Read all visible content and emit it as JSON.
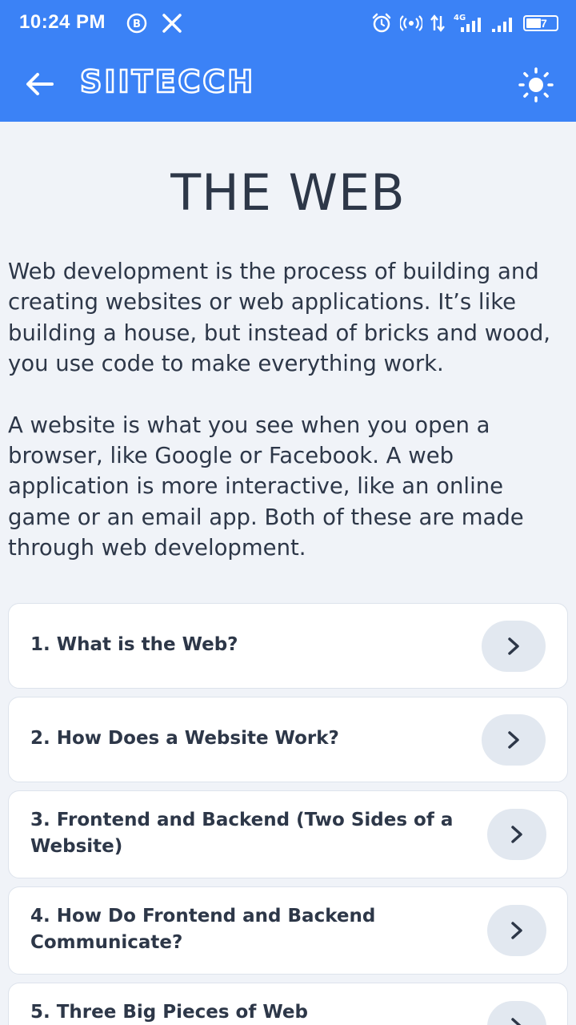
{
  "status_bar": {
    "time": "10:24 PM",
    "left_icons": [
      "b-circle-icon",
      "x-logo-icon"
    ],
    "right_icons": [
      "alarm-icon",
      "hotspot-icon",
      "data-arrows-icon",
      "signal-4g-icon",
      "signal-icon"
    ],
    "network_label": "4G",
    "battery_percent": "47"
  },
  "app_bar": {
    "brand": "SIITECCH",
    "back_icon": "arrow-left-icon",
    "theme_icon": "sun-icon"
  },
  "page": {
    "title": "THE WEB",
    "paragraphs": [
      "Web development is the process of building and creating websites or web applications. It’s like building a house, but instead of bricks and wood, you use code to make everything work.",
      "A website is what you see when you open a browser, like Google or Facebook. A web application is more interactive, like an online game or an email app. Both of these are made through web development."
    ]
  },
  "topics": [
    {
      "label": "1. What is the Web?"
    },
    {
      "label": "2. How Does a Website Work?"
    },
    {
      "label": "3. Frontend and Backend (Two Sides of a Website)"
    },
    {
      "label": "4. How Do Frontend and Backend Communicate?"
    },
    {
      "label": "5. Three Big Pieces of Web"
    }
  ],
  "colors": {
    "accent": "#3b82f6",
    "background": "#f0f3f8",
    "text": "#2d3748",
    "chevron_bg": "#e2e8f0"
  }
}
